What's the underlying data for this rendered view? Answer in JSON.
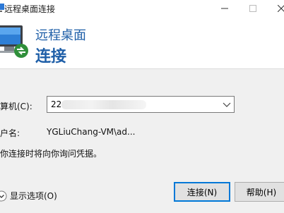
{
  "window": {
    "title": "远程桌面连接"
  },
  "header": {
    "product": "远程桌面",
    "action": "连接"
  },
  "form": {
    "computer_label": "算机(C):",
    "computer_value": "22",
    "username_label": "户名:",
    "username_value": "YGLiuChang-VM\\ad...",
    "note": "你连接时将向你询问凭据。"
  },
  "footer": {
    "options_label": "显示选项(O)",
    "connect_label": "连接(N)",
    "help_label": "帮助(H)"
  },
  "icons": {
    "title": "remote-desktop-icon",
    "logo": "remote-desktop-monitor-icon",
    "options": "chevron-down-circle-icon",
    "combo": "chevron-down-icon"
  },
  "colors": {
    "accent": "#1f5fa8",
    "default_button_border": "#0078d7"
  }
}
